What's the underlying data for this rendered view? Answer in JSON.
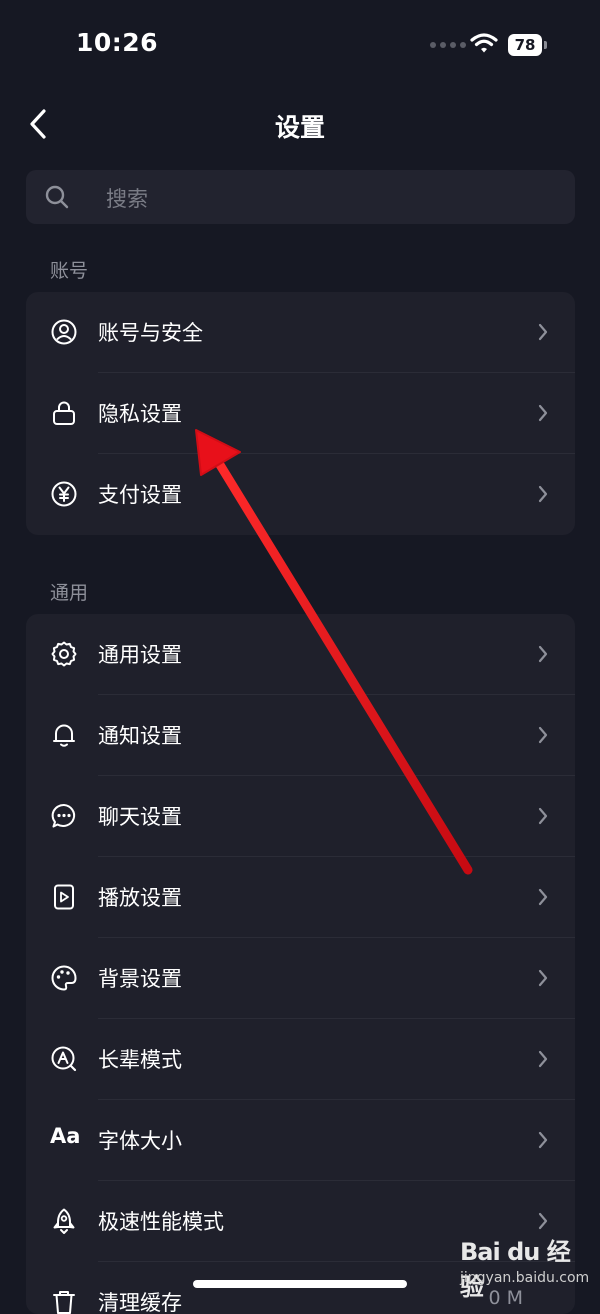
{
  "status_bar": {
    "time": "10:26",
    "battery": "78"
  },
  "nav": {
    "title": "设置"
  },
  "search": {
    "placeholder": "搜索"
  },
  "sections": {
    "account": {
      "label": "账号",
      "items": [
        {
          "label": "账号与安全",
          "icon": "user-circle-icon"
        },
        {
          "label": "隐私设置",
          "icon": "lock-icon"
        },
        {
          "label": "支付设置",
          "icon": "yen-circle-icon"
        }
      ]
    },
    "general": {
      "label": "通用",
      "items": [
        {
          "label": "通用设置",
          "icon": "gear-icon"
        },
        {
          "label": "通知设置",
          "icon": "bell-icon"
        },
        {
          "label": "聊天设置",
          "icon": "chat-bubble-icon"
        },
        {
          "label": "播放设置",
          "icon": "play-icon"
        },
        {
          "label": "背景设置",
          "icon": "palette-icon"
        },
        {
          "label": "长辈模式",
          "icon": "elder-mode-icon"
        },
        {
          "label": "字体大小",
          "icon": "font-size-icon",
          "glyph": "Aa"
        },
        {
          "label": "极速性能模式",
          "icon": "rocket-icon"
        },
        {
          "label": "清理缓存",
          "icon": "trash-icon",
          "value": "0 M"
        }
      ]
    }
  },
  "annotation": {
    "arrow_color": "#e8101a"
  },
  "watermark": {
    "logo": "Bai du 经验",
    "url": "jingyan.baidu.com"
  }
}
